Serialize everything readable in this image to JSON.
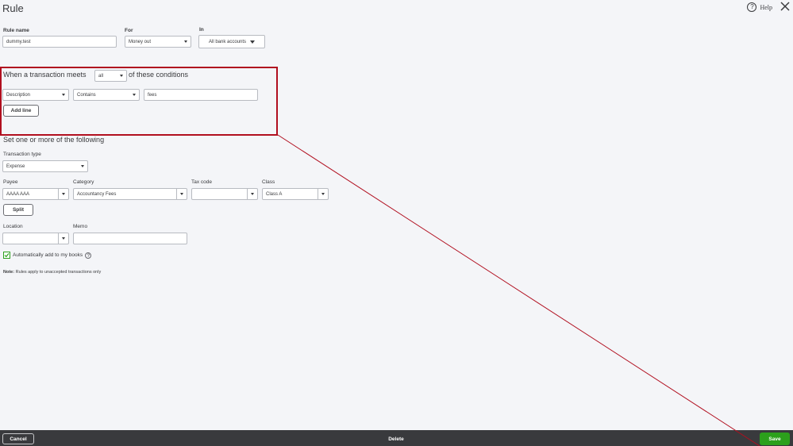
{
  "header": {
    "title": "Rule",
    "help_label": "Help",
    "help_icon_glyph": "?"
  },
  "rule_name": {
    "label": "Rule name",
    "value": "dummy.test"
  },
  "for_field": {
    "label": "For",
    "value": "Money out"
  },
  "in_field": {
    "label": "In",
    "value": "All bank accounts"
  },
  "conditions": {
    "prefix": "When a transaction meets",
    "match_value": "all",
    "suffix": "of these conditions",
    "row": {
      "field": "Description",
      "operator": "Contains",
      "value": "fees"
    },
    "add_line_label": "Add line"
  },
  "actions": {
    "title": "Set one or more of the following",
    "transaction_type": {
      "label": "Transaction type",
      "value": "Expense"
    },
    "payee": {
      "label": "Payee",
      "value": "AAAA AAA"
    },
    "category": {
      "label": "Category",
      "value": "Accountancy Fees"
    },
    "tax_code": {
      "label": "Tax code",
      "value": ""
    },
    "class": {
      "label": "Class",
      "value": "Class A"
    },
    "split_label": "Split",
    "location": {
      "label": "Location",
      "value": ""
    },
    "memo": {
      "label": "Memo",
      "value": ""
    },
    "auto_add": {
      "label": "Automatically add to my books",
      "checked": true
    },
    "note_bold": "Note:",
    "note_text": " Rules apply to unaccepted transactions only"
  },
  "footer": {
    "cancel_label": "Cancel",
    "delete_label": "Delete",
    "save_label": "Save"
  },
  "colors": {
    "accent_green": "#2ca01c",
    "annotation_red": "#b10f1f",
    "footer_bg": "#393a3d"
  }
}
